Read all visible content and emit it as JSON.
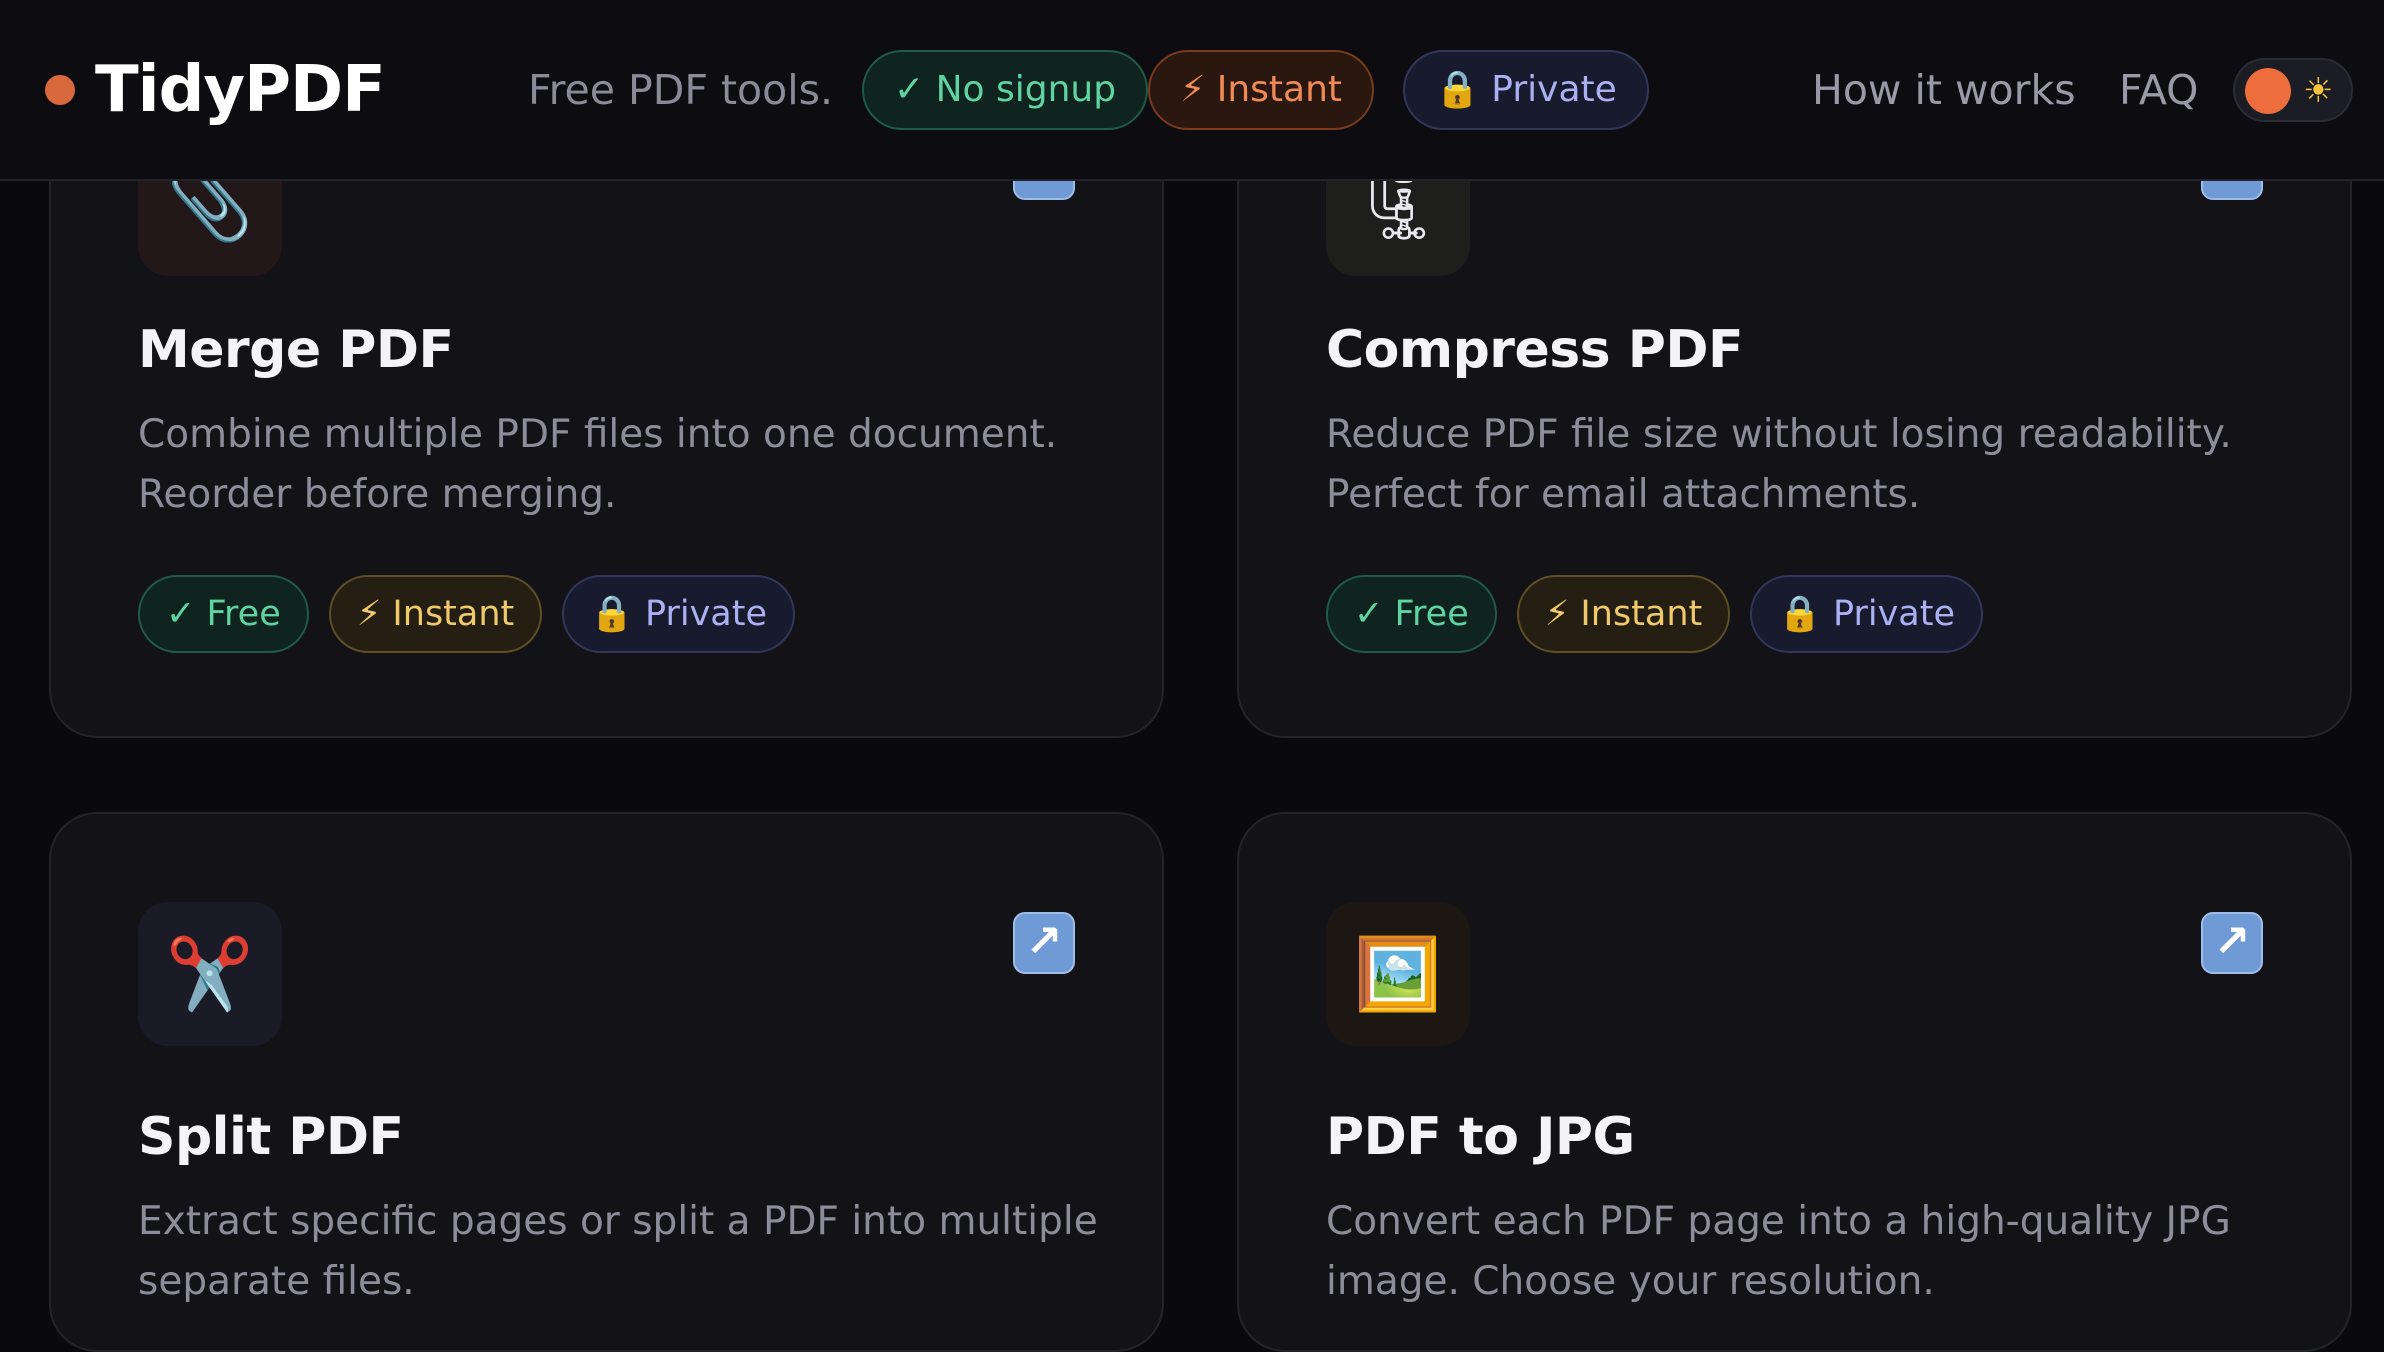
{
  "header": {
    "brand": "TidyPDF",
    "tagline": "Free PDF tools.",
    "badges": [
      {
        "label": "✓ No signup",
        "tone": "green"
      },
      {
        "label": "⚡ Instant",
        "tone": "orange"
      },
      {
        "label": "🔒 Private",
        "tone": "indigo"
      }
    ],
    "nav": [
      {
        "label": "How it works"
      },
      {
        "label": "FAQ"
      }
    ],
    "theme_toggle": {
      "icon": "☀",
      "state": "dark"
    }
  },
  "tools": [
    {
      "title": "Merge PDF",
      "icon": "📎",
      "icon_name": "paperclip-icon",
      "description": "Combine multiple PDF files into one document. Reorder before merging.",
      "tags": [
        "✓ Free",
        "⚡ Instant",
        "🔒 Private"
      ],
      "arrow": "↗"
    },
    {
      "title": "Compress PDF",
      "icon": "🗜",
      "icon_name": "clamp-icon",
      "description": "Reduce PDF file size without losing readability. Perfect for email attachments.",
      "tags": [
        "✓ Free",
        "⚡ Instant",
        "🔒 Private"
      ],
      "arrow": "↗"
    },
    {
      "title": "Split PDF",
      "icon": "✂️",
      "icon_name": "scissors-icon",
      "description": "Extract specific pages or split a PDF into multiple separate files.",
      "tags": [],
      "arrow": "↗"
    },
    {
      "title": "PDF to JPG",
      "icon": "🖼️",
      "icon_name": "framed-picture-icon",
      "description": "Convert each PDF page into a high-quality JPG image. Choose your resolution.",
      "tags": [],
      "arrow": "↗"
    }
  ],
  "colors": {
    "background": "#0a0a0d",
    "card": "#121217",
    "accent": "#d9683c",
    "tag_green": "#5fd3a2",
    "tag_amber": "#f0c96b",
    "tag_indigo": "#aab0f2"
  }
}
